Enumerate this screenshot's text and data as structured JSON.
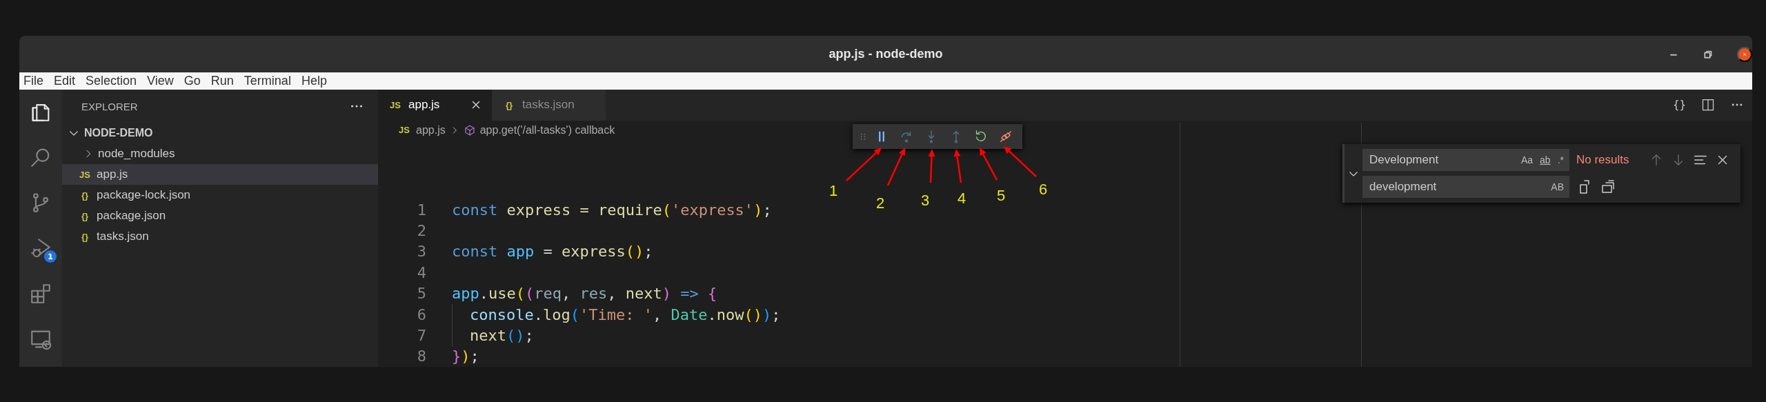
{
  "window": {
    "title": "app.js - node-demo"
  },
  "menu": [
    "File",
    "Edit",
    "Selection",
    "View",
    "Go",
    "Run",
    "Terminal",
    "Help"
  ],
  "activity_bar": [
    {
      "kind": "files",
      "selected": true
    },
    {
      "kind": "search",
      "selected": false
    },
    {
      "kind": "source-control",
      "selected": false
    },
    {
      "kind": "run-debug",
      "selected": false,
      "badge": "1"
    },
    {
      "kind": "extensions",
      "selected": false
    },
    {
      "kind": "remote",
      "selected": false
    }
  ],
  "sidebar": {
    "title": "EXPLORER",
    "folder": {
      "name": "NODE-DEMO",
      "expanded": true
    },
    "items": [
      {
        "kind": "folder",
        "name": "node_modules",
        "expanded": false,
        "selected": false
      },
      {
        "kind": "file",
        "icon_text": "JS",
        "name": "app.js",
        "selected": true
      },
      {
        "kind": "file",
        "icon_text": "{}",
        "name": "package-lock.json",
        "selected": false
      },
      {
        "kind": "file",
        "icon_text": "{}",
        "name": "package.json",
        "selected": false
      },
      {
        "kind": "file",
        "icon_text": "{}",
        "name": "tasks.json",
        "selected": false
      }
    ]
  },
  "tabs": [
    {
      "icon_text": "JS",
      "label": "app.js",
      "selected": true
    },
    {
      "icon_text": "{}",
      "label": "tasks.json",
      "selected": false
    }
  ],
  "editor_actions": {
    "format_text": "{}"
  },
  "breadcrumb": [
    {
      "kind": "file",
      "icon_text": "JS",
      "label": "app.js"
    },
    {
      "kind": "method",
      "label": "app.get('/all-tasks') callback"
    }
  ],
  "debug_toolbar": [
    {
      "kind": "pause",
      "disabled": false
    },
    {
      "kind": "step-over",
      "disabled": true
    },
    {
      "kind": "step-into",
      "disabled": true
    },
    {
      "kind": "step-out",
      "disabled": true
    },
    {
      "kind": "restart",
      "disabled": false
    },
    {
      "kind": "disconnect",
      "disabled": false
    }
  ],
  "annotations": [
    "1",
    "2",
    "3",
    "4",
    "5",
    "6"
  ],
  "code": [
    {
      "number": "1",
      "tokens": [
        {
          "t": "const",
          "kind": "keyword"
        },
        {
          "t": " express = ",
          "kind": "function"
        },
        {
          "t": "require",
          "kind": "function"
        },
        {
          "t": "(",
          "kind": "bracket1"
        },
        {
          "t": "'express'",
          "kind": "string"
        },
        {
          "t": ")",
          "kind": "bracket1"
        },
        {
          "t": ";",
          "kind": "punct"
        }
      ]
    },
    {
      "number": "2"
    },
    {
      "number": "3",
      "tokens": [
        {
          "t": "const ",
          "kind": "keyword"
        },
        {
          "t": "app",
          "kind": "constant"
        },
        {
          "t": " = ",
          "kind": "punct"
        },
        {
          "t": "express",
          "kind": "function"
        },
        {
          "t": "()",
          "kind": "bracket1"
        },
        {
          "t": ";",
          "kind": "punct"
        }
      ]
    },
    {
      "number": "4"
    },
    {
      "number": "5",
      "tokens": [
        {
          "t": "app",
          "kind": "constant"
        },
        {
          "t": ".",
          "kind": "punct"
        },
        {
          "t": "use",
          "kind": "function"
        },
        {
          "t": "(",
          "kind": "bracket1"
        },
        {
          "t": "(",
          "kind": "bracket2"
        },
        {
          "t": "req",
          "kind": "param"
        },
        {
          "t": ", ",
          "kind": "punct"
        },
        {
          "t": "res",
          "kind": "param"
        },
        {
          "t": ", ",
          "kind": "punct"
        },
        {
          "t": "next",
          "kind": "function"
        },
        {
          "t": ")",
          "kind": "bracket2"
        },
        {
          "t": " => ",
          "kind": "keyword"
        },
        {
          "t": "{",
          "kind": "bracket2"
        }
      ]
    },
    {
      "number": "6",
      "indented": true,
      "tokens": [
        {
          "t": "console",
          "kind": "variable"
        },
        {
          "t": ".",
          "kind": "punct"
        },
        {
          "t": "log",
          "kind": "function"
        },
        {
          "t": "(",
          "kind": "bracket3"
        },
        {
          "t": "'Time: '",
          "kind": "string"
        },
        {
          "t": ", ",
          "kind": "punct"
        },
        {
          "t": "Date",
          "kind": "type"
        },
        {
          "t": ".",
          "kind": "punct"
        },
        {
          "t": "now",
          "kind": "function"
        },
        {
          "t": "()",
          "kind": "bracket1"
        },
        {
          "t": ")",
          "kind": "bracket3"
        },
        {
          "t": ";",
          "kind": "punct"
        }
      ]
    },
    {
      "number": "7",
      "indented": true,
      "tokens": [
        {
          "t": "next",
          "kind": "function"
        },
        {
          "t": "()",
          "kind": "bracket3"
        },
        {
          "t": ";",
          "kind": "punct"
        }
      ]
    },
    {
      "number": "8",
      "tokens": [
        {
          "t": "}",
          "kind": "bracket2"
        },
        {
          "t": ")",
          "kind": "bracket1"
        },
        {
          "t": ";",
          "kind": "punct"
        }
      ]
    }
  ],
  "find": {
    "expanded": true,
    "find_value": "Development",
    "find_options": [
      "Aa",
      "ab",
      ".*"
    ],
    "status": "No results",
    "replace_value": "development",
    "replace_option": "AB"
  }
}
